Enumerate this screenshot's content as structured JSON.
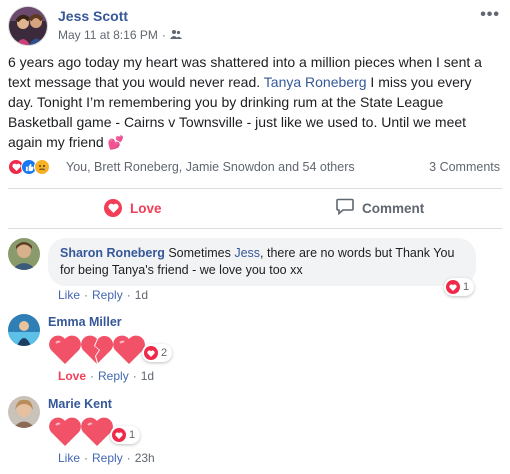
{
  "post": {
    "author": "Jess Scott",
    "timestamp": "May 11 at 8:16 PM",
    "text_before_mention": "6 years ago today my heart was shattered into a million pieces when I sent a text message that you would never read. ",
    "mention": "Tanya Roneberg",
    "text_after_mention": " I miss you every day. Tonight I’m remembering you by drinking rum at the State League Basketball game - Cairns v Townsville - just like we used to. Until we meet again my friend ",
    "more_menu": "•••",
    "audience_icon": "friends-icon",
    "inline_emoji": "💕"
  },
  "summary": {
    "reaction_icons": [
      "love",
      "like",
      "sad"
    ],
    "names": "You, Brett Roneberg, Jamie Snowdon and 54 others",
    "comments_count": "3 Comments"
  },
  "actions": {
    "love_label": "Love",
    "comment_label": "Comment"
  },
  "comments": [
    {
      "name": "Sharon Roneberg",
      "text_before_mention": " Sometimes ",
      "mention": "Jess",
      "text_after_mention": ", there are no words but Thank You for being Tanya's friend - we love you too xx",
      "like": "Like",
      "reply": "Reply",
      "time": "1d",
      "reaction_count": "1"
    },
    {
      "name": "Emma Miller",
      "sticker": "three hearts, middle one broken",
      "like": "Love",
      "reply": "Reply",
      "time": "1d",
      "reaction_count": "2"
    },
    {
      "name": "Marie Kent",
      "sticker": "two hearts",
      "like": "Like",
      "reply": "Reply",
      "time": "23h",
      "reaction_count": "1"
    }
  ],
  "colors": {
    "link_blue": "#365899",
    "love_red": "#f33e58",
    "heart_pink": "#f25268",
    "meta_gray": "#606770",
    "bubble_bg": "#f2f3f5"
  },
  "separator": "·"
}
